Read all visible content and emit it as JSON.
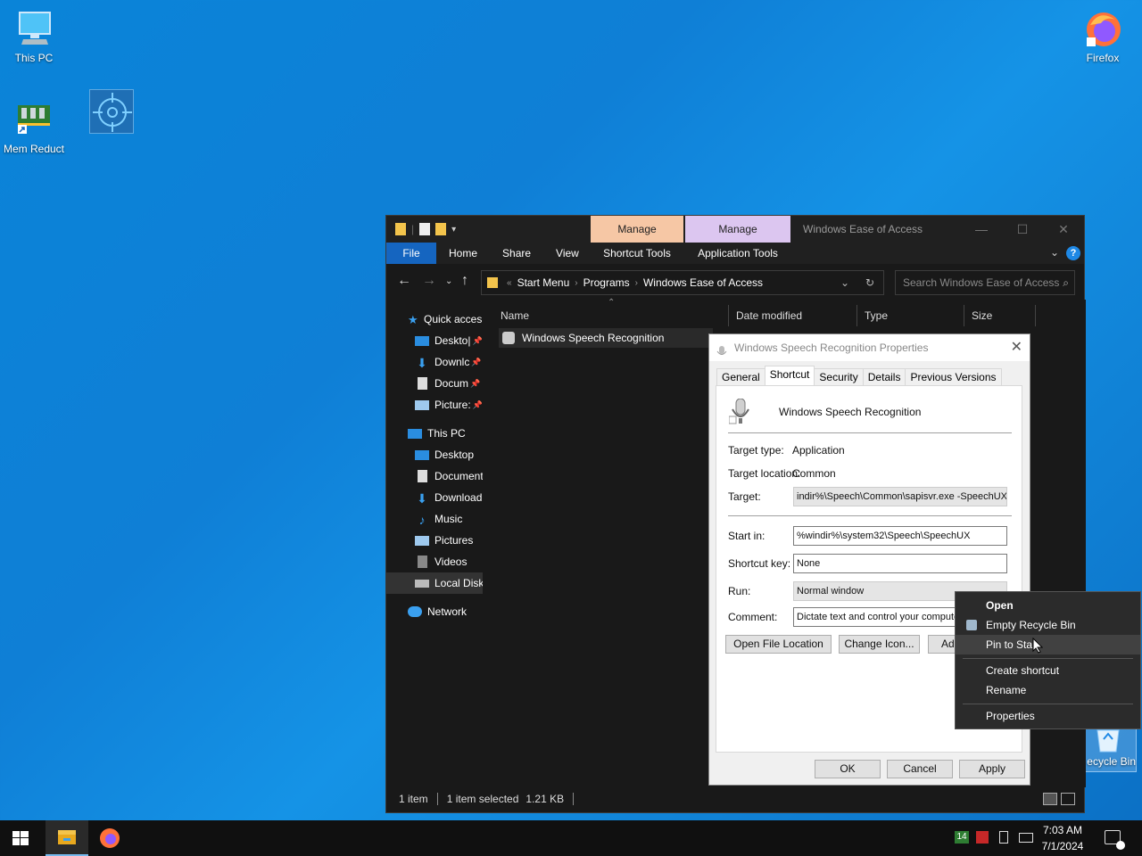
{
  "desktop": {
    "icons": {
      "this_pc": "This PC",
      "mem_reduct": "Mem Reduct",
      "firefox": "Firefox",
      "recycle_bin": "ecycle Bin"
    }
  },
  "explorer": {
    "title": "Windows Ease of Access",
    "context_tabs": [
      "Manage",
      "Manage"
    ],
    "ribbon": {
      "file": "File",
      "tabs": [
        "Home",
        "Share",
        "View"
      ],
      "tool_tabs": [
        "Shortcut Tools",
        "Application Tools"
      ]
    },
    "breadcrumb": [
      "Start Menu",
      "Programs",
      "Windows Ease of Access"
    ],
    "search_placeholder": "Search Windows Ease of Access",
    "nav": {
      "quick_access": "Quick acces",
      "qa_items": [
        "Deskto|",
        "Downlc",
        "Docum",
        "Picture:"
      ],
      "this_pc": "This PC",
      "pc_items": [
        "Desktop",
        "Document",
        "Download",
        "Music",
        "Pictures",
        "Videos",
        "Local Disk"
      ],
      "network": "Network"
    },
    "columns": [
      "Name",
      "Date modified",
      "Type",
      "Size"
    ],
    "file": "Windows Speech Recognition",
    "status": {
      "count": "1 item",
      "selected": "1 item selected",
      "size": "1.21 KB"
    }
  },
  "properties": {
    "title": "Windows Speech Recognition Properties",
    "tabs": [
      "General",
      "Shortcut",
      "Security",
      "Details",
      "Previous Versions"
    ],
    "name": "Windows Speech Recognition",
    "target_type_label": "Target type:",
    "target_type": "Application",
    "target_location_label": "Target location:",
    "target_location": "Common",
    "target_label": "Target:",
    "target": "indir%\\Speech\\Common\\sapisvr.exe -SpeechUX",
    "start_in_label": "Start in:",
    "start_in": "%windir%\\system32\\Speech\\SpeechUX",
    "shortcut_key_label": "Shortcut key:",
    "shortcut_key": "None",
    "run_label": "Run:",
    "run": "Normal window",
    "comment_label": "Comment:",
    "comment": "Dictate text and control your compute",
    "buttons": {
      "open_location": "Open File Location",
      "change_icon": "Change Icon...",
      "advanced": "Ad",
      "ok": "OK",
      "cancel": "Cancel",
      "apply": "Apply"
    }
  },
  "context_menu": {
    "open": "Open",
    "empty": "Empty Recycle Bin",
    "pin": "Pin to Star",
    "create_shortcut": "Create shortcut",
    "rename": "Rename",
    "properties": "Properties"
  },
  "taskbar": {
    "badge": "14",
    "time": "7:03 AM",
    "date": "7/1/2024"
  }
}
